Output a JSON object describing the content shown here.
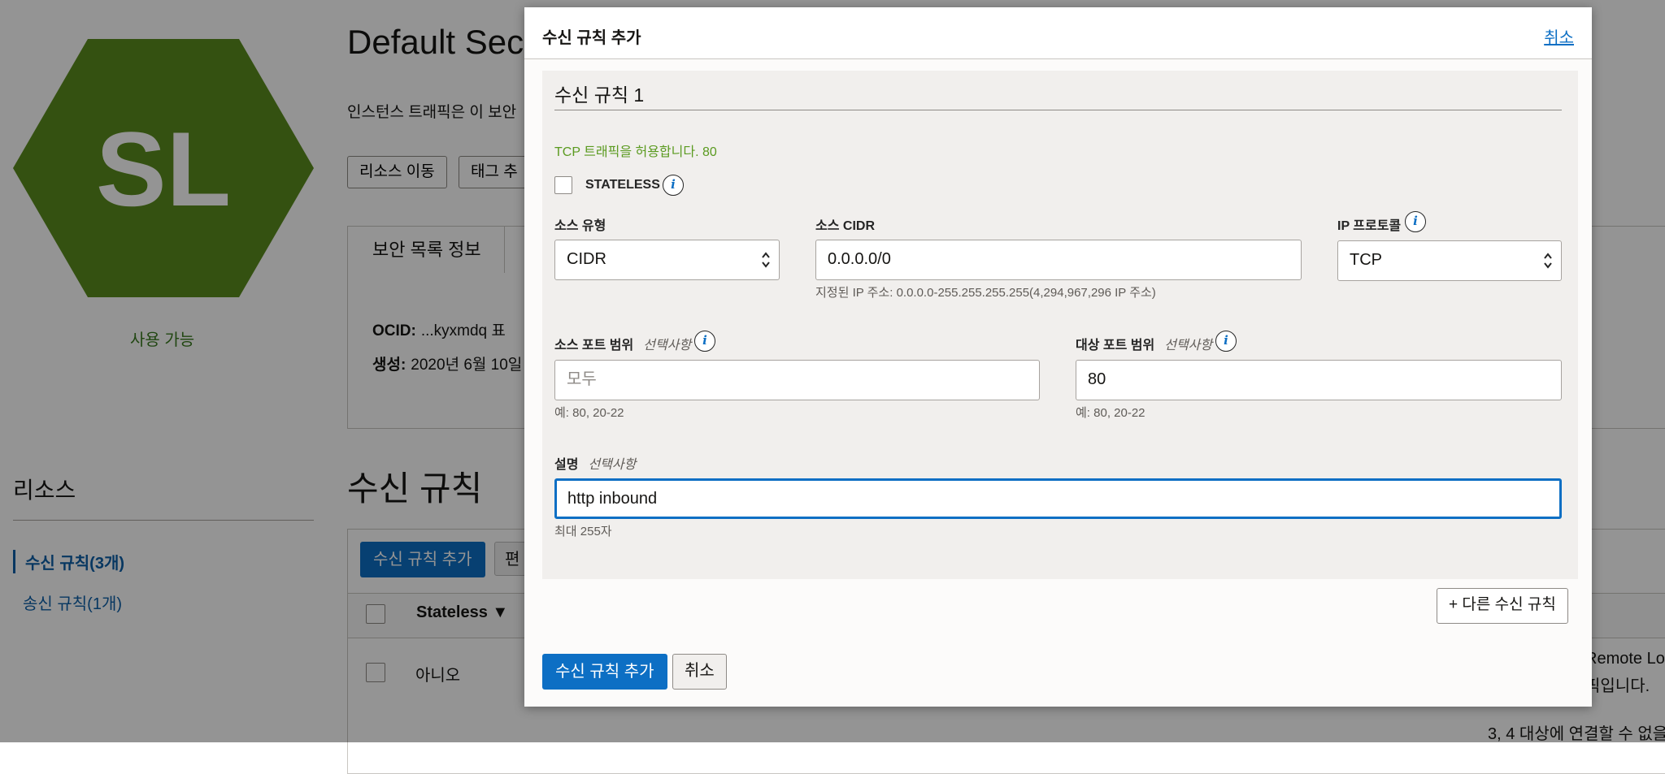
{
  "background": {
    "logo_text": "SL",
    "status": "사용 가능",
    "title": "Default Secu",
    "description": "인스턴스 트래픽은 이 보안",
    "move_resource_button": "리소스 이동",
    "add_tag_button": "태그 추",
    "info_tab": "보안 목록 정보",
    "ocid_label": "OCID:",
    "ocid_value": "...kyxmdq  표",
    "created_label": "생성:",
    "created_value": "2020년 6월 10일",
    "resources_title": "리소스",
    "resource_items": [
      "수신 규칙(3개)",
      "송신 규칙(1개)"
    ],
    "ingress_title": "수신 규칙",
    "add_ingress_button": "수신 규칙 추가",
    "edit_button": "편",
    "col_stateless": "Stateless",
    "row_value": "아니오",
    "right_text_1": "Remote Lo",
    "right_text_2": "픽입니다.",
    "bottom_text": "3, 4 대상에 연결할 수 없을"
  },
  "modal": {
    "title": "수신 규칙 추가",
    "cancel_link": "취소",
    "rule_title": "수신 규칙 1",
    "hint": "TCP 트래픽을 허용합니다. 80",
    "stateless_label": "STATELESS",
    "source_type": {
      "label": "소스 유형",
      "value": "CIDR"
    },
    "source_cidr": {
      "label": "소스 CIDR",
      "value": "0.0.0.0/0",
      "help": "지정된 IP 주소: 0.0.0.0-255.255.255.255(4,294,967,296 IP 주소)"
    },
    "ip_protocol": {
      "label": "IP 프로토콜",
      "value": "TCP"
    },
    "source_port": {
      "label": "소스 포트 범위",
      "optional": "선택사항",
      "placeholder": "모두",
      "help": "예: 80, 20-22"
    },
    "dest_port": {
      "label": "대상 포트 범위",
      "optional": "선택사항",
      "value": "80",
      "help": "예: 80, 20-22"
    },
    "description": {
      "label": "설명",
      "optional": "선택사항",
      "value": "http inbound",
      "help": "최대 255자"
    },
    "add_another_button": "+ 다른 수신 규칙",
    "submit_button": "수신 규칙 추가",
    "cancel_button": "취소"
  },
  "colors": {
    "primary": "#0d6fc4",
    "logo_green": "#5b8c1e",
    "hint_green": "#5a9a1f"
  }
}
